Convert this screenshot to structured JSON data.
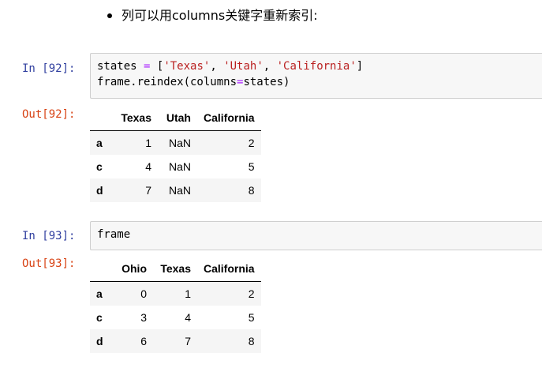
{
  "markdown": {
    "bullet_text": "列可以用columns关键字重新索引:"
  },
  "cell92": {
    "in_prompt": "In  [92]:",
    "code_line1": {
      "p1": "states ",
      "op": "=",
      "p2": " [",
      "s1": "'Texas'",
      "c1": ", ",
      "s2": "'Utah'",
      "c2": ", ",
      "s3": "'California'",
      "p3": "]"
    },
    "code_line2": {
      "p1": "frame.reindex(columns",
      "op": "=",
      "p2": "states)"
    },
    "out_prompt": "Out[92]:",
    "table": {
      "columns": [
        "Texas",
        "Utah",
        "California"
      ],
      "rows": [
        {
          "index": "a",
          "values": [
            "1",
            "NaN",
            "2"
          ]
        },
        {
          "index": "c",
          "values": [
            "4",
            "NaN",
            "5"
          ]
        },
        {
          "index": "d",
          "values": [
            "7",
            "NaN",
            "8"
          ]
        }
      ]
    }
  },
  "cell93": {
    "in_prompt": "In  [93]:",
    "code_line1": "frame",
    "out_prompt": "Out[93]:",
    "table": {
      "columns": [
        "Ohio",
        "Texas",
        "California"
      ],
      "rows": [
        {
          "index": "a",
          "values": [
            "0",
            "1",
            "2"
          ]
        },
        {
          "index": "c",
          "values": [
            "3",
            "4",
            "5"
          ]
        },
        {
          "index": "d",
          "values": [
            "6",
            "7",
            "8"
          ]
        }
      ]
    }
  }
}
